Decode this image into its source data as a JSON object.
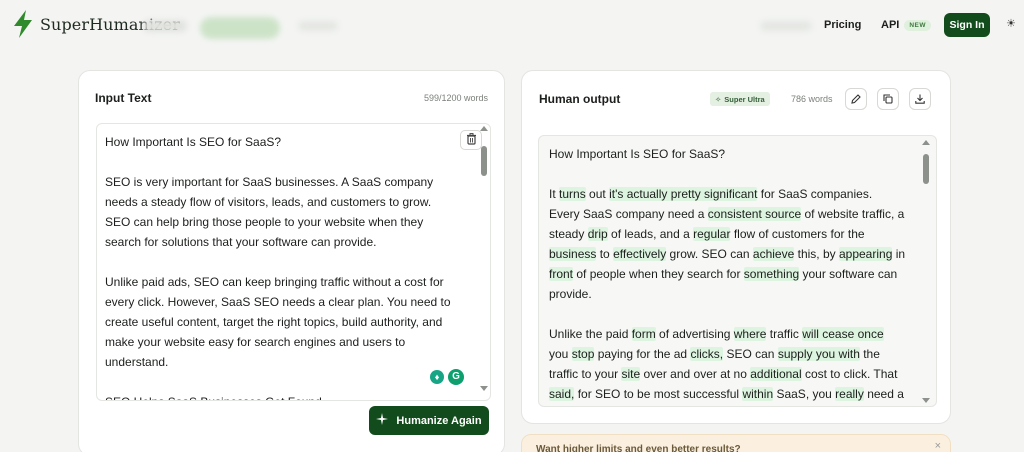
{
  "brand": {
    "name": "SuperHumanizer",
    "accent": "#134c1c",
    "icon": "lightning-bolt-icon"
  },
  "nav": {
    "pricing": "Pricing",
    "api": "API",
    "api_badge": "NEW",
    "signin": "Sign In",
    "theme_icon": "sun-icon"
  },
  "input": {
    "title": "Input Text",
    "word_count": "599/1200 words",
    "paragraphs": [
      "How Important Is SEO for SaaS?",
      "SEO is very important for SaaS businesses. A SaaS company needs a steady flow of visitors, leads, and customers to grow. SEO can help bring those people to your website when they search for solutions that your software can provide.",
      "Unlike paid ads, SEO can keep bringing traffic without a cost for every click. However, SaaS SEO needs a clear plan. You need to create useful content, target the right topics, build authority, and make your website easy for search engines and users to understand.",
      "SEO Helps SaaS Businesses Get Found"
    ],
    "action_label": "Humanize Again"
  },
  "output": {
    "title": "Human output",
    "mode_label": "Super Ultra",
    "word_count": "786 words",
    "heading": "How Important Is SEO for SaaS?",
    "para1": [
      [
        [
          "It ",
          false
        ],
        [
          "turns",
          true
        ],
        [
          " out ",
          false
        ],
        [
          "it's actually pretty significant",
          true
        ],
        [
          " for SaaS companies.",
          false
        ]
      ],
      [
        [
          "Every SaaS company need a ",
          false
        ],
        [
          "consistent source",
          true
        ],
        [
          " of website traffic, a",
          false
        ]
      ],
      [
        [
          "steady ",
          false
        ],
        [
          "drip",
          true
        ],
        [
          " of leads, and a ",
          false
        ],
        [
          "regular",
          true
        ],
        [
          " flow of customers for the",
          false
        ]
      ],
      [
        [
          "business",
          true
        ],
        [
          " to ",
          false
        ],
        [
          "effectively",
          true
        ],
        [
          " grow.  SEO can ",
          false
        ],
        [
          "achieve",
          true
        ],
        [
          " this, by ",
          false
        ],
        [
          "appearing",
          true
        ],
        [
          " in",
          false
        ]
      ],
      [
        [
          "front",
          true
        ],
        [
          " of people when they search for ",
          false
        ],
        [
          "something",
          true
        ],
        [
          " your software can",
          false
        ]
      ],
      [
        [
          "provide.",
          false
        ]
      ]
    ],
    "para2": [
      [
        [
          "Unlike the paid ",
          false
        ],
        [
          "form",
          true
        ],
        [
          " of advertising ",
          false
        ],
        [
          "where",
          true
        ],
        [
          " traffic ",
          false
        ],
        [
          "will cease once",
          true
        ]
      ],
      [
        [
          "you ",
          false
        ],
        [
          "stop",
          true
        ],
        [
          " paying for the ad ",
          false
        ],
        [
          "clicks,",
          true
        ],
        [
          " SEO can ",
          false
        ],
        [
          "supply you with",
          true
        ],
        [
          " the",
          false
        ]
      ],
      [
        [
          "traffic to your ",
          false
        ],
        [
          "site",
          true
        ],
        [
          " over and over at no ",
          false
        ],
        [
          "additional",
          true
        ],
        [
          " cost to click.  That",
          false
        ]
      ],
      [
        [
          "said,",
          true
        ],
        [
          " for SEO to be most successful ",
          false
        ],
        [
          "within",
          true
        ],
        [
          " SaaS, you ",
          false
        ],
        [
          "really",
          true
        ],
        [
          " need a",
          false
        ]
      ]
    ]
  },
  "banner": {
    "text": "Want higher limits and even better results?",
    "close": "×"
  }
}
